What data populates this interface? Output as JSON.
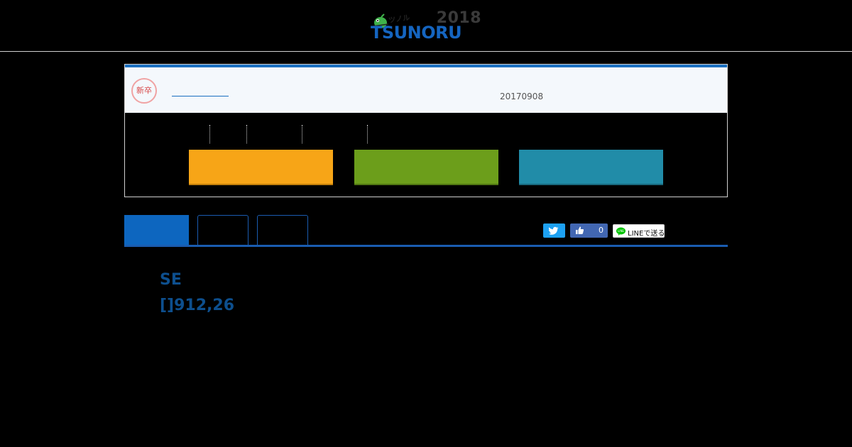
{
  "header": {
    "logo_year": "2018",
    "logo_brand": "TSUNORU",
    "logo_kana": "ツノル"
  },
  "card": {
    "stamp_label": "新卒",
    "date": "20170908",
    "action_buttons": [
      {
        "color": "#f7a517"
      },
      {
        "color": "#6c9e1b"
      },
      {
        "color": "#218ca8"
      }
    ]
  },
  "share": {
    "facebook_count": "0",
    "line_label": "LINEで送る",
    "twitter_icon": "twitter-bird-icon",
    "facebook_icon": "thumbs-up-icon",
    "line_icon": "line-chat-icon"
  },
  "main": {
    "title_line1": "SE",
    "title_line2": "[]912,26"
  },
  "colors": {
    "accent": "#1a6fc0",
    "title": "#0d4f8e"
  }
}
